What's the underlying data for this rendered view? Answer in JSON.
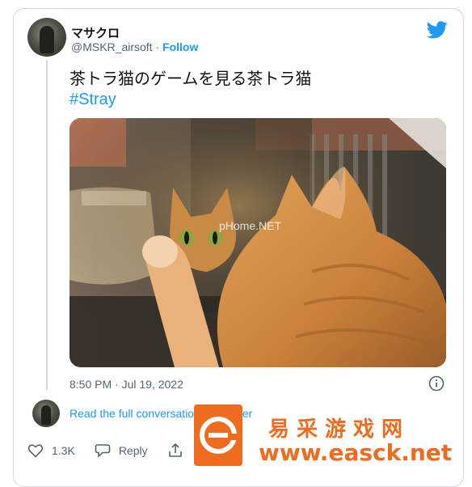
{
  "tweet": {
    "author_name": "マサクロ",
    "handle": "@MSKR_airsoft",
    "separator": "·",
    "follow_label": "Follow",
    "text": "茶トラ猫のゲームを見る茶トラ猫",
    "hashtag": "#Stray",
    "media_overlay_text": "pHome.NET",
    "timestamp": "8:50 PM · Jul 19, 2022"
  },
  "conversation": {
    "read_link": "Read the full conversation on Twitter"
  },
  "actions": {
    "likes": "1.3K",
    "reply_label": "Reply"
  },
  "watermark": {
    "title": "易采游戏网",
    "url": "www.easck.net"
  },
  "colors": {
    "brand_blue": "#1d9bf0",
    "text_secondary": "#536471",
    "border": "#cfd9de",
    "watermark_orange": "#ee6b1f"
  },
  "icons": [
    "twitter-bird-icon",
    "info-icon",
    "heart-icon",
    "reply-icon",
    "share-icon"
  ]
}
